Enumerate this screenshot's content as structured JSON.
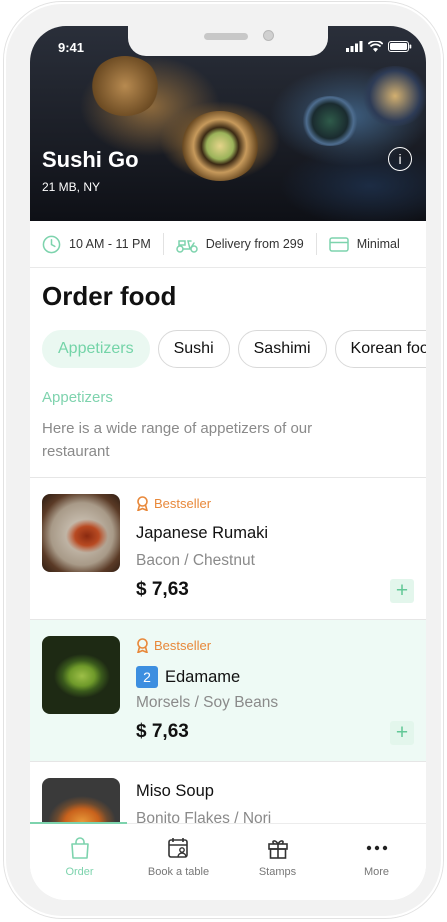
{
  "status_bar": {
    "time": "9:41"
  },
  "restaurant": {
    "name": "Sushi Go",
    "location": "21 MB, NY"
  },
  "info": {
    "hours": "10 AM - 11 PM",
    "delivery": "Delivery from 299",
    "minimal": "Minimal"
  },
  "page_title": "Order food",
  "categories": [
    "Appetizers",
    "Sushi",
    "Sashimi",
    "Korean food"
  ],
  "active_category": "Appetizers",
  "section": {
    "title": "Appetizers",
    "description": "Here is a wide range of appetizers of our restaurant"
  },
  "items": [
    {
      "badge": "Bestseller",
      "name": "Japanese Rumaki",
      "qty": "",
      "desc": "Bacon / Chestnut",
      "price": "$ 7,63"
    },
    {
      "badge": "Bestseller",
      "name": "Edamame",
      "qty": "2",
      "desc": "Morsels / Soy Beans",
      "price": "$ 7,63"
    },
    {
      "badge": "",
      "name": "Miso Soup",
      "qty": "",
      "desc": "Bonito Flakes / Nori",
      "price": ""
    }
  ],
  "tabs": [
    {
      "label": "Order",
      "icon": "bag-icon"
    },
    {
      "label": "Book a table",
      "icon": "calendar-user-icon"
    },
    {
      "label": "Stamps",
      "icon": "gift-icon"
    },
    {
      "label": "More",
      "icon": "more-dots-icon"
    }
  ],
  "colors": {
    "accent": "#7dd3ad",
    "badge": "#e8883a",
    "qty_badge": "#3d8fe0",
    "selected_row": "#eefaf5"
  }
}
